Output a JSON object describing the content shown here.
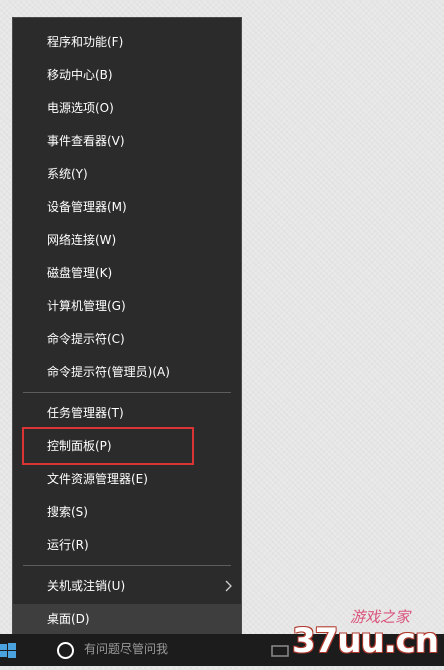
{
  "menu": {
    "items": [
      {
        "label": "程序和功能(F)"
      },
      {
        "label": "移动中心(B)"
      },
      {
        "label": "电源选项(O)"
      },
      {
        "label": "事件查看器(V)"
      },
      {
        "label": "系统(Y)"
      },
      {
        "label": "设备管理器(M)"
      },
      {
        "label": "网络连接(W)"
      },
      {
        "label": "磁盘管理(K)"
      },
      {
        "label": "计算机管理(G)"
      },
      {
        "label": "命令提示符(C)"
      },
      {
        "label": "命令提示符(管理员)(A)"
      },
      {
        "label": "任务管理器(T)"
      },
      {
        "label": "控制面板(P)"
      },
      {
        "label": "文件资源管理器(E)"
      },
      {
        "label": "搜索(S)"
      },
      {
        "label": "运行(R)"
      },
      {
        "label": "关机或注销(U)",
        "submenu_icon": "chevron-right-icon"
      },
      {
        "label": "桌面(D)"
      }
    ],
    "highlighted_item": "控制面板(P)",
    "hovered_item": "桌面(D)"
  },
  "taskbar": {
    "search_placeholder": "有问题尽管问我",
    "icons": [
      "windows-start-icon",
      "cortana-icon"
    ]
  },
  "watermark": {
    "text": "37uu.cn",
    "script_text": "游戏之家"
  },
  "colors": {
    "menu_bg": "#2b2b2b",
    "highlight_border": "#d93535",
    "start_icon": "#4aa3df",
    "watermark_outline": "#b03a2e"
  }
}
